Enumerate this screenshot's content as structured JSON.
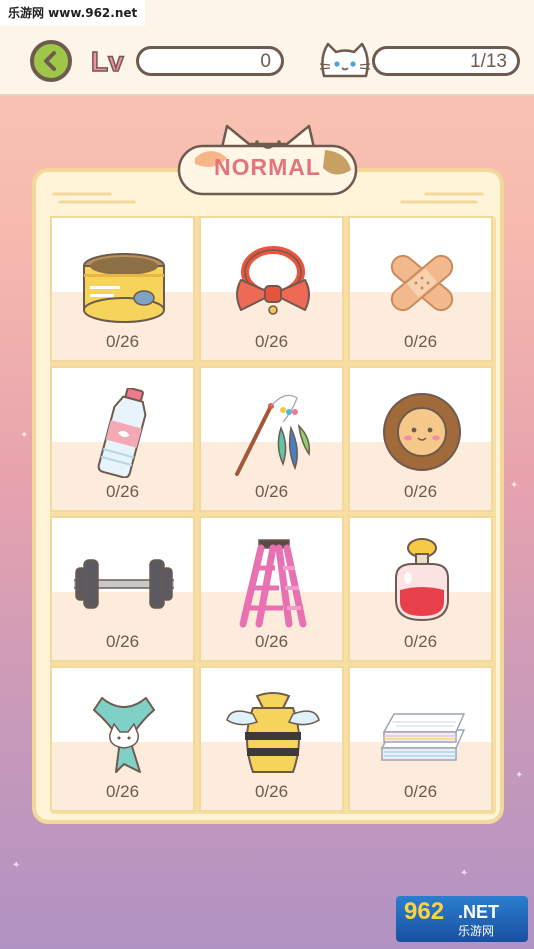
{
  "watermark_top": "乐游网 www.962.net",
  "header": {
    "level_label": "Lv",
    "level_value": "0",
    "collection_count": "1/13"
  },
  "panel": {
    "title": "NORMAL"
  },
  "items": [
    {
      "name": "cat-food-can",
      "count": "0/26"
    },
    {
      "name": "red-bow-collar",
      "count": "0/26"
    },
    {
      "name": "bandage",
      "count": "0/26"
    },
    {
      "name": "water-bottle",
      "count": "0/26"
    },
    {
      "name": "feather-wand",
      "count": "0/26"
    },
    {
      "name": "lion-plush",
      "count": "0/26"
    },
    {
      "name": "dumbbell",
      "count": "0/26"
    },
    {
      "name": "pink-ladder",
      "count": "0/26"
    },
    {
      "name": "perfume-bottle",
      "count": "0/26"
    },
    {
      "name": "cat-scarf",
      "count": "0/26"
    },
    {
      "name": "bee-costume",
      "count": "0/26"
    },
    {
      "name": "towel-stack",
      "count": "0/26"
    }
  ],
  "watermark_bottom": {
    "big": "962",
    "net": ".NET",
    "sub": "乐游网"
  },
  "colors": {
    "accent_text": "#e4737a",
    "outline": "#6e5a4f",
    "back_button": "#9fc747",
    "panel_fill": "#fff3d8",
    "panel_border": "#f2d89b"
  }
}
